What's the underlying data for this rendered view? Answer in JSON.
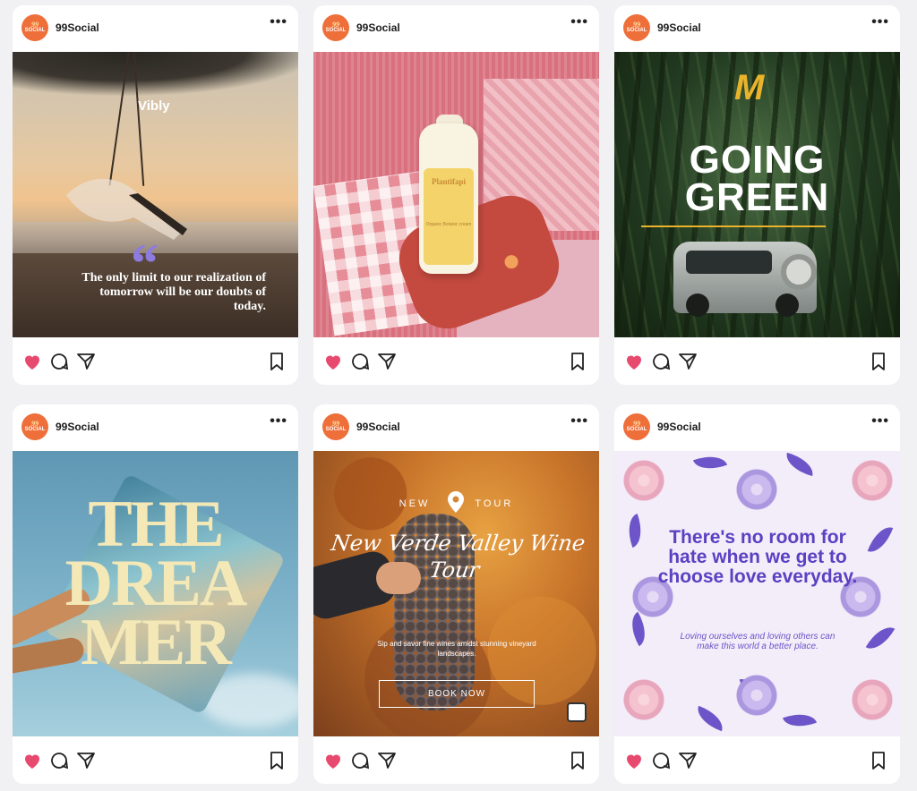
{
  "account": {
    "username": "99Social",
    "avatar_top": "99",
    "avatar_bottom": "SOCIAL",
    "more": "•••"
  },
  "colors": {
    "like": "#e8496f",
    "accent_orange": "#ee6f3a",
    "purple": "#5b40c2",
    "gold": "#e9b32a"
  },
  "icons": {
    "like": "heart-icon",
    "comment": "comment-icon",
    "share": "send-icon",
    "save": "bookmark-icon"
  },
  "posts": [
    {
      "brand": "Vibly",
      "quote_mark": "“",
      "quote": "The only limit to our realization of tomorrow will be our doubts of today.",
      "liked": true
    },
    {
      "bottle_brand": "Plantifapi",
      "bottle_text": "Organic Botanic cream",
      "liked": true
    },
    {
      "logo": "M",
      "title": "GOING GREEN",
      "liked": true
    },
    {
      "line1": "THE",
      "line2": "DREA",
      "line3": "MER",
      "liked": true
    },
    {
      "kicker_left": "NEW",
      "kicker_right": "TOUR",
      "title": "New Verde Valley Wine Tour",
      "description": "Sip and savor fine wines amidst stunning vineyard landscapes.",
      "cta": "BOOK NOW",
      "liked": true
    },
    {
      "headline": "There's no room for hate when we get to choose love everyday.",
      "sub": "Loving ourselves and loving others can make this world a better place.",
      "liked": true
    }
  ]
}
